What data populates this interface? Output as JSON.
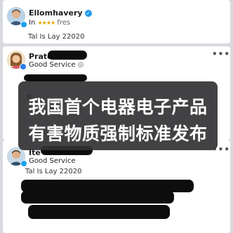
{
  "posts": [
    {
      "author": "Ellomhavery",
      "subtitle_prefix": "In",
      "subtitle_stars": "★★★★",
      "subtitle_suffix": "fres",
      "meta": "Tal Is Lay 22020"
    },
    {
      "author": "Prate",
      "subtitle": "Good Service",
      "subtitle_icon": "◎",
      "more": "•••",
      "peek_text": "R"
    },
    {
      "author": "Ite",
      "subtitle": "Good Service",
      "meta": "Tal Is Lay 22020",
      "more": "•••"
    }
  ],
  "overlay": {
    "line1": "我国首个电器电子产品",
    "line2": "有害物质强制标准发布"
  },
  "colors": {
    "verified": "#1d9bf0",
    "stars": "#e9a400",
    "overlay_bg": "#323234",
    "redaction": "#0d0d0d"
  }
}
